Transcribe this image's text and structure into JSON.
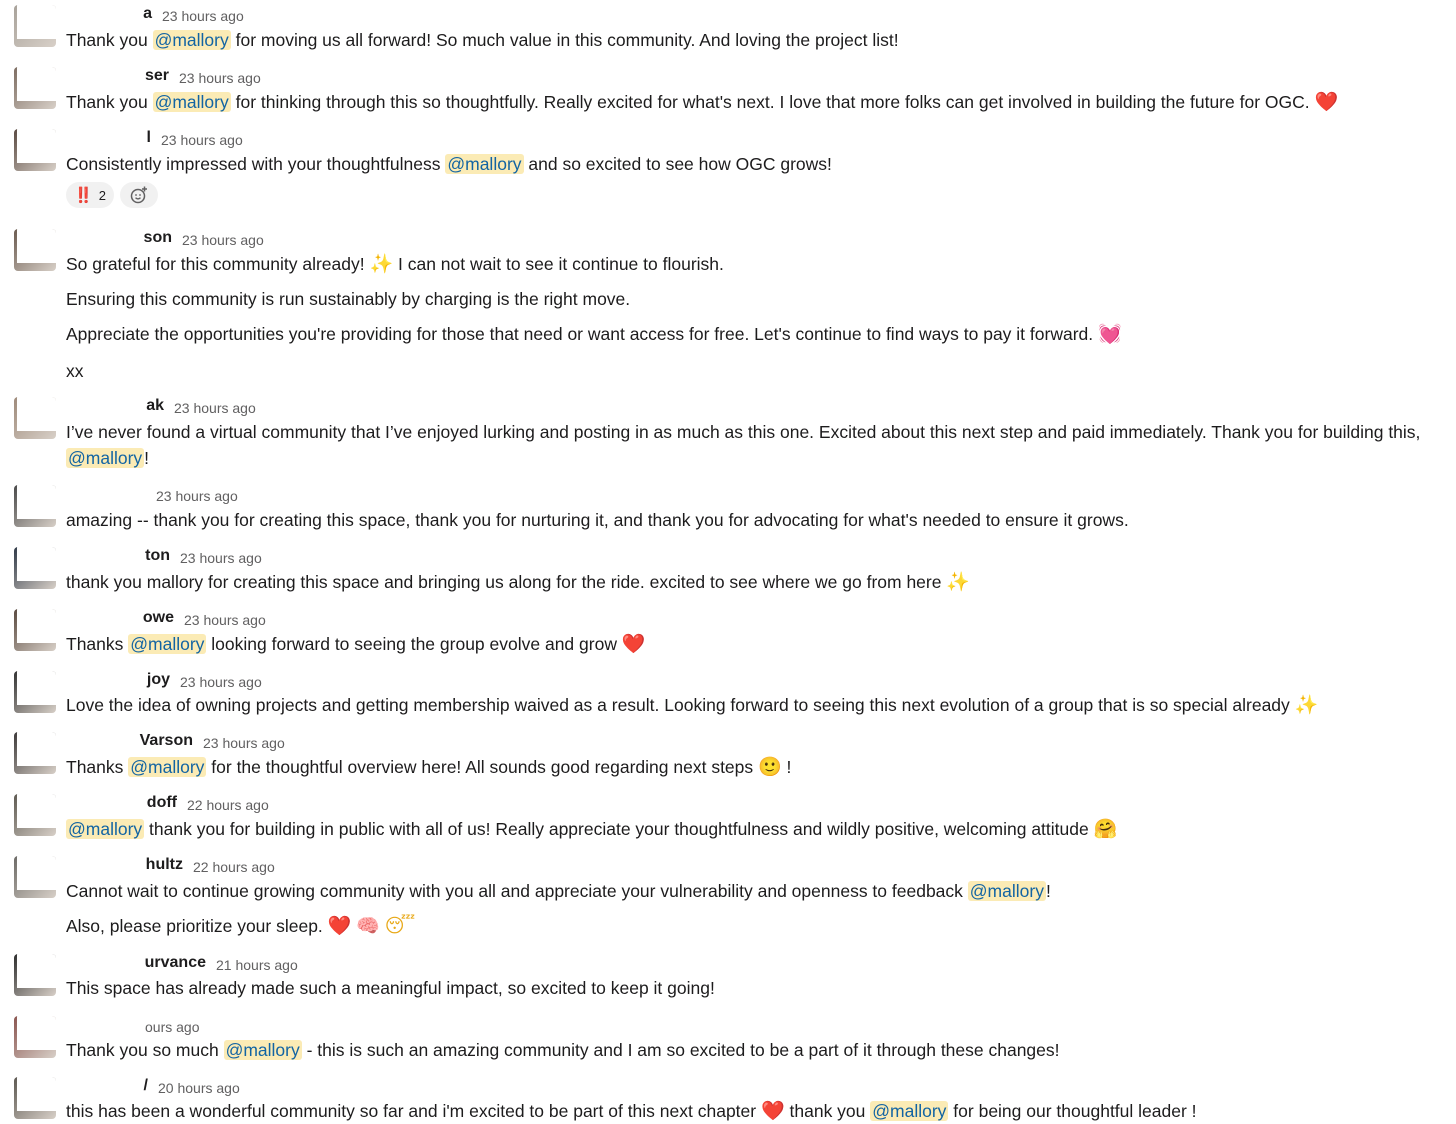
{
  "messages": [
    {
      "name": "a",
      "time": "23 hours ago",
      "lines": [
        [
          {
            "t": "Thank you "
          },
          {
            "t": "@mallory",
            "m": 1
          },
          {
            "t": " for moving us all forward! So much value in this community. And loving the project list!"
          }
        ]
      ]
    },
    {
      "name": "ser",
      "time": "23 hours ago",
      "lines": [
        [
          {
            "t": "Thank you "
          },
          {
            "t": "@mallory",
            "m": 1
          },
          {
            "t": " for thinking through this so thoughtfully. Really excited for what's next. I love that more folks can get involved in building the future for OGC. "
          },
          {
            "t": "❤️",
            "e": "heart-emoji",
            "c": "#e0243a"
          }
        ]
      ]
    },
    {
      "name": "l",
      "time": "23 hours ago",
      "lines": [
        [
          {
            "t": "Consistently impressed with your thoughtfulness "
          },
          {
            "t": "@mallory",
            "m": 1
          },
          {
            "t": " and so excited to see how OGC grows!"
          }
        ]
      ],
      "reactions": [
        {
          "emoji": "‼️",
          "count": "2"
        }
      ]
    },
    {
      "name": "son",
      "time": "23 hours ago",
      "lines": [
        [
          {
            "t": "So grateful for this community already! "
          },
          {
            "t": "✨",
            "e": "sparkles-emoji",
            "c": "#f5c518"
          },
          {
            "t": " I can not wait to see it continue to flourish."
          }
        ],
        [
          {
            "t": "Ensuring this community is run sustainably by charging is the right move."
          }
        ],
        [
          {
            "t": "Appreciate the opportunities you're providing for those that need or want access for free. Let's continue to find ways to pay it forward. "
          },
          {
            "t": "💓",
            "e": "beating-heart-emoji",
            "c": "#e7448b"
          }
        ],
        [
          {
            "t": "xx"
          }
        ]
      ]
    },
    {
      "name": "ak",
      "time": "23 hours ago",
      "lines": [
        [
          {
            "t": "I’ve never found a virtual community that I’ve enjoyed lurking and posting in as much as this one. Excited about this next step and paid immediately. Thank you for building this,"
          }
        ],
        [
          {
            "t": "@mallory",
            "m": 1
          },
          {
            "t": "!"
          }
        ]
      ]
    },
    {
      "name": "",
      "time": "23 hours ago",
      "lines": [
        [
          {
            "t": "amazing -- thank you for creating this space, thank you for nurturing it, and thank you for advocating for what's needed to ensure it grows."
          }
        ]
      ]
    },
    {
      "name": "ton",
      "time": "23 hours ago",
      "lines": [
        [
          {
            "t": "thank you mallory for creating this space and bringing us along for the ride. excited to see where we go from here "
          },
          {
            "t": "✨",
            "e": "sparkles-emoji",
            "c": "#f5c518"
          }
        ]
      ]
    },
    {
      "name": "owe",
      "time": "23 hours ago",
      "lines": [
        [
          {
            "t": "Thanks "
          },
          {
            "t": "@mallory",
            "m": 1
          },
          {
            "t": " looking forward to seeing the group evolve and grow "
          },
          {
            "t": "❤️",
            "e": "heart-emoji",
            "c": "#e0243a"
          }
        ]
      ]
    },
    {
      "name": "joy",
      "time": "23 hours ago",
      "lines": [
        [
          {
            "t": "Love the idea of owning projects and getting membership waived as a result. Looking forward to seeing this next evolution of a group that is so special already "
          },
          {
            "t": "✨",
            "e": "sparkles-emoji",
            "c": "#f5c518"
          }
        ]
      ]
    },
    {
      "name": "Varson",
      "time": "23 hours ago",
      "lines": [
        [
          {
            "t": "Thanks "
          },
          {
            "t": "@mallory",
            "m": 1
          },
          {
            "t": " for the thoughtful overview here! All sounds good regarding next steps "
          },
          {
            "t": "🙂",
            "e": "smile-emoji",
            "c": "#e8a817"
          },
          {
            "t": " !"
          }
        ]
      ]
    },
    {
      "name": "doff",
      "time": "22 hours ago",
      "lines": [
        [
          {
            "t": "@mallory",
            "m": 1
          },
          {
            "t": " thank you for building in public with all of us! Really appreciate your thoughtfulness and wildly positive, welcoming attitude "
          },
          {
            "t": "🤗",
            "e": "hug-emoji",
            "c": "#e8a817"
          }
        ]
      ]
    },
    {
      "name": "hultz",
      "time": "22 hours ago",
      "lines": [
        [
          {
            "t": "Cannot wait to continue growing community with you all and appreciate your vulnerability and openness to feedback "
          },
          {
            "t": "@mallory",
            "m": 1
          },
          {
            "t": "!"
          }
        ],
        [
          {
            "t": "Also, please prioritize your sleep. "
          },
          {
            "t": "❤️",
            "e": "heart-emoji",
            "c": "#e0243a"
          },
          {
            "t": " "
          },
          {
            "t": "🧠",
            "e": "brain-emoji",
            "c": "#e889a6"
          },
          {
            "t": " "
          },
          {
            "t": "😴",
            "e": "sleeping-emoji",
            "c": "#e8a817"
          }
        ]
      ]
    },
    {
      "name": "urvance",
      "time": "21 hours ago",
      "lines": [
        [
          {
            "t": "This space has already made such a meaningful impact, so excited to keep it going!"
          }
        ]
      ]
    },
    {
      "name": "",
      "time": "ours ago",
      "lines": [
        [
          {
            "t": "Thank you so much "
          },
          {
            "t": "@mallory",
            "m": 1
          },
          {
            "t": " - this is such an amazing community and I am so excited to be a part of it through these changes!"
          }
        ]
      ]
    },
    {
      "name": "/",
      "time": "20 hours ago",
      "lines": [
        [
          {
            "t": "this has been a wonderful community so far and i'm excited to be part of this next chapter "
          },
          {
            "t": "❤️",
            "e": "heart-emoji",
            "c": "#e0243a"
          },
          {
            "t": " thank you "
          },
          {
            "t": "@mallory",
            "m": 1
          },
          {
            "t": " for being our thoughtful leader !"
          }
        ]
      ]
    }
  ],
  "colors": {
    "mention_bg": "#fbebb5",
    "mention_fg": "#1264a3",
    "timestamp": "#616061"
  },
  "icons": {
    "add_reaction": "add-reaction-icon"
  }
}
